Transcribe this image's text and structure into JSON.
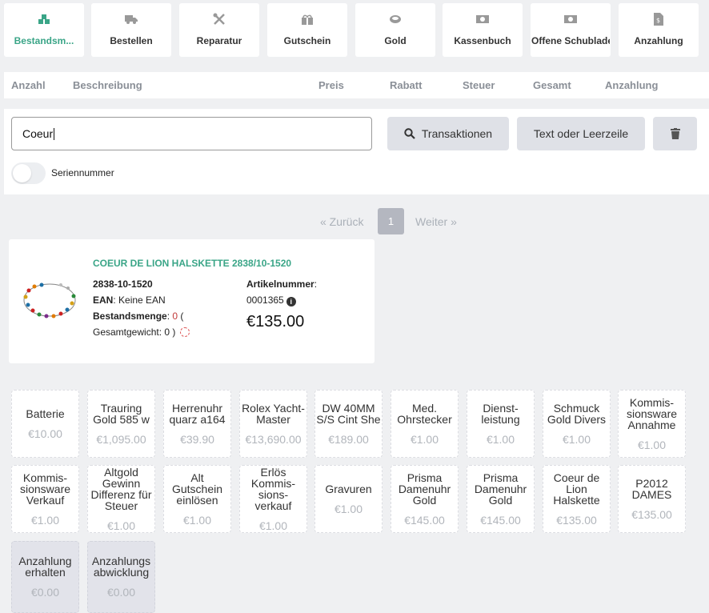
{
  "tabs": [
    {
      "label": "Bestandsm...",
      "icon": "boxes-icon",
      "active": true
    },
    {
      "label": "Bestellen",
      "icon": "truck-icon"
    },
    {
      "label": "Reparatur",
      "icon": "tools-icon"
    },
    {
      "label": "Gutschein",
      "icon": "gift-icon"
    },
    {
      "label": "Gold",
      "icon": "ring-icon"
    },
    {
      "label": "Kassenbuch",
      "icon": "money-icon"
    },
    {
      "label": "Offene Schublade",
      "icon": "cash-drawer-icon"
    },
    {
      "label": "Anzahlung",
      "icon": "invoice-icon"
    }
  ],
  "columns": [
    "Anzahl",
    "Beschreibung",
    "Preis",
    "Rabatt",
    "Steuer",
    "Gesamt",
    "Anzahlung"
  ],
  "search": {
    "value": "Coeur"
  },
  "buttons": {
    "transactions": "Transaktionen",
    "text_line": "Text oder Leerzeile"
  },
  "serial_toggle": {
    "label": "Seriennummer",
    "on": false
  },
  "pagination": {
    "prev": "«  Zurück",
    "current": "1",
    "next": "Weiter  »"
  },
  "product": {
    "title": "COEUR DE LION HALSKETTE 2838/10-1520",
    "sku": "2838-10-1520",
    "ean_label": "EAN",
    "ean_value": ": Keine EAN",
    "stock_label": "Bestandsmenge",
    "stock_sep": ": ",
    "stock_value": "0",
    "stock_open": " (",
    "weight_line": "Gesamtgewicht: 0 )",
    "article_label": "Artikelnummer",
    "article_colon": ":",
    "article_number": "0001365",
    "price": "€135.00"
  },
  "quick_items": [
    {
      "name": "Batterie",
      "price": "€10.00"
    },
    {
      "name": "Trauring Gold 585 w",
      "price": "€1,095.00"
    },
    {
      "name": "Herrenuhr quarz a164",
      "price": "€39.90"
    },
    {
      "name": "Rolex Yacht-Master",
      "price": "€13,690.00"
    },
    {
      "name": "DW 40MM S/S Cint She",
      "price": "€189.00"
    },
    {
      "name": "Med. Ohrstecker",
      "price": "€1.00"
    },
    {
      "name": "Dienst-leistung",
      "price": "€1.00"
    },
    {
      "name": "Schmuck Gold Divers",
      "price": "€1.00"
    },
    {
      "name": "Kommis-sionsware Annahme",
      "price": "€1.00"
    },
    {
      "name": "Kommis-sionsware Verkauf",
      "price": "€1.00"
    },
    {
      "name": "Altgold Gewinn Differenz für Steuer",
      "price": "€1.00"
    },
    {
      "name": "Alt Gutschein einlösen",
      "price": "€1.00"
    },
    {
      "name": "Erlös Kommis-sions-verkauf",
      "price": "€1.00"
    },
    {
      "name": "Gravuren",
      "price": "€1.00"
    },
    {
      "name": "Prisma Damenuhr Gold",
      "price": "€145.00"
    },
    {
      "name": "Prisma Damenuhr Gold",
      "price": "€145.00"
    },
    {
      "name": "Coeur de Lion Halskette",
      "price": "€135.00"
    },
    {
      "name": "P2012 DAMES",
      "price": "€135.00"
    },
    {
      "name": "Anzahlung erhalten",
      "price": "€0.00",
      "deposit": true
    },
    {
      "name": "Anzahlungs abwicklung",
      "price": "€0.00",
      "deposit": true
    }
  ],
  "colors": {
    "accent": "#3aa587",
    "button": "#dfe1e7",
    "stock_zero": "#c23b3b"
  }
}
